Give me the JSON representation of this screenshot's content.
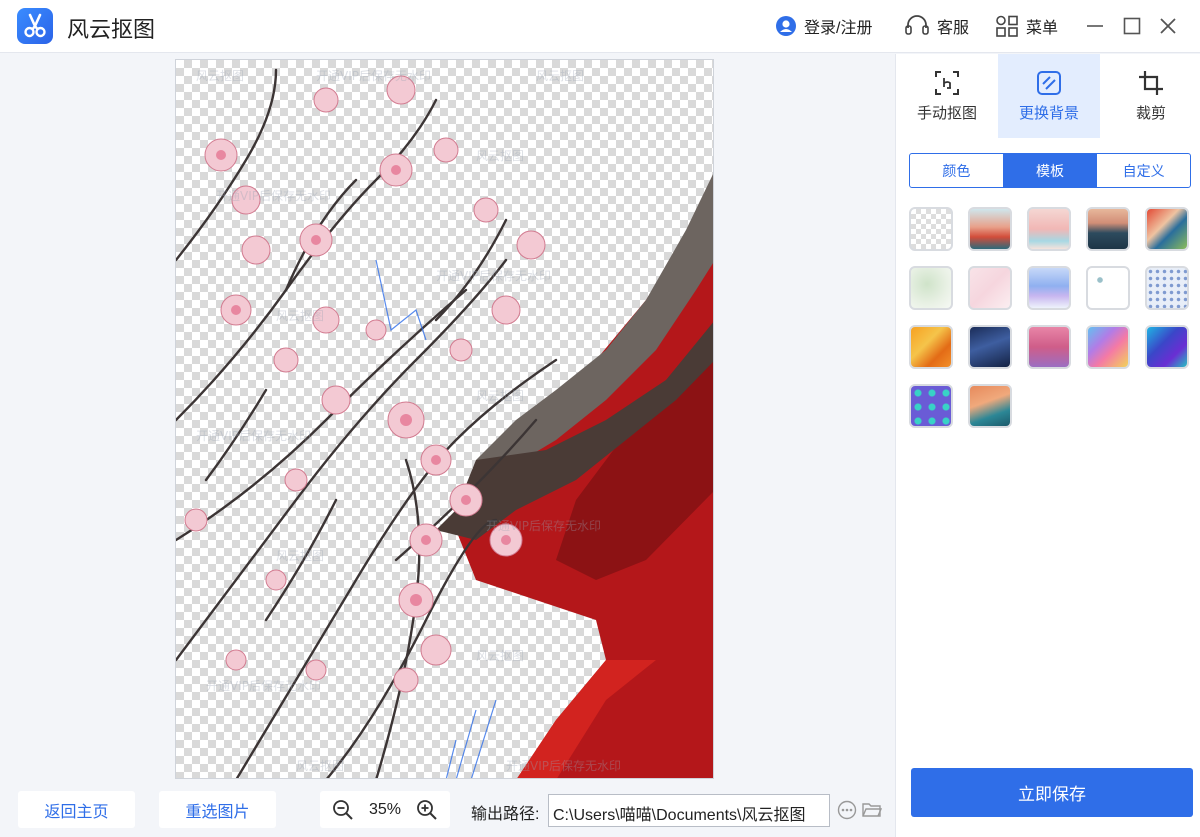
{
  "app": {
    "title": "风云抠图"
  },
  "header": {
    "login_label": "登录/注册",
    "service_label": "客服",
    "menu_label": "菜单"
  },
  "tools": [
    {
      "label": "手动抠图",
      "icon": "manual-cutout-icon"
    },
    {
      "label": "更换背景",
      "icon": "change-background-icon",
      "active": true
    },
    {
      "label": "裁剪",
      "icon": "crop-icon"
    }
  ],
  "bg_tabs": [
    {
      "label": "颜色"
    },
    {
      "label": "模板",
      "active": true
    },
    {
      "label": "自定义"
    }
  ],
  "templates": [
    "transparent",
    "mountain-sunset",
    "pink-sky",
    "dark-mountain",
    "abstract-red-green",
    "green-floral",
    "pink-marble",
    "blue-waves",
    "blue-leaves",
    "blue-pattern",
    "orange-paint",
    "navy-shape",
    "pink-clouds",
    "colorful-abstract",
    "blue-purple-swirl",
    "purple-circles",
    "orange-gradient"
  ],
  "footer": {
    "back_home": "返回主页",
    "reselect": "重选图片",
    "zoom": "35%",
    "output_label": "输出路径:",
    "output_path": "C:\\Users\\喵喵\\Documents\\风云抠图"
  },
  "save_button": "立即保存",
  "colors": {
    "accent": "#2f6ee8",
    "accent_light": "#e3edfe"
  }
}
